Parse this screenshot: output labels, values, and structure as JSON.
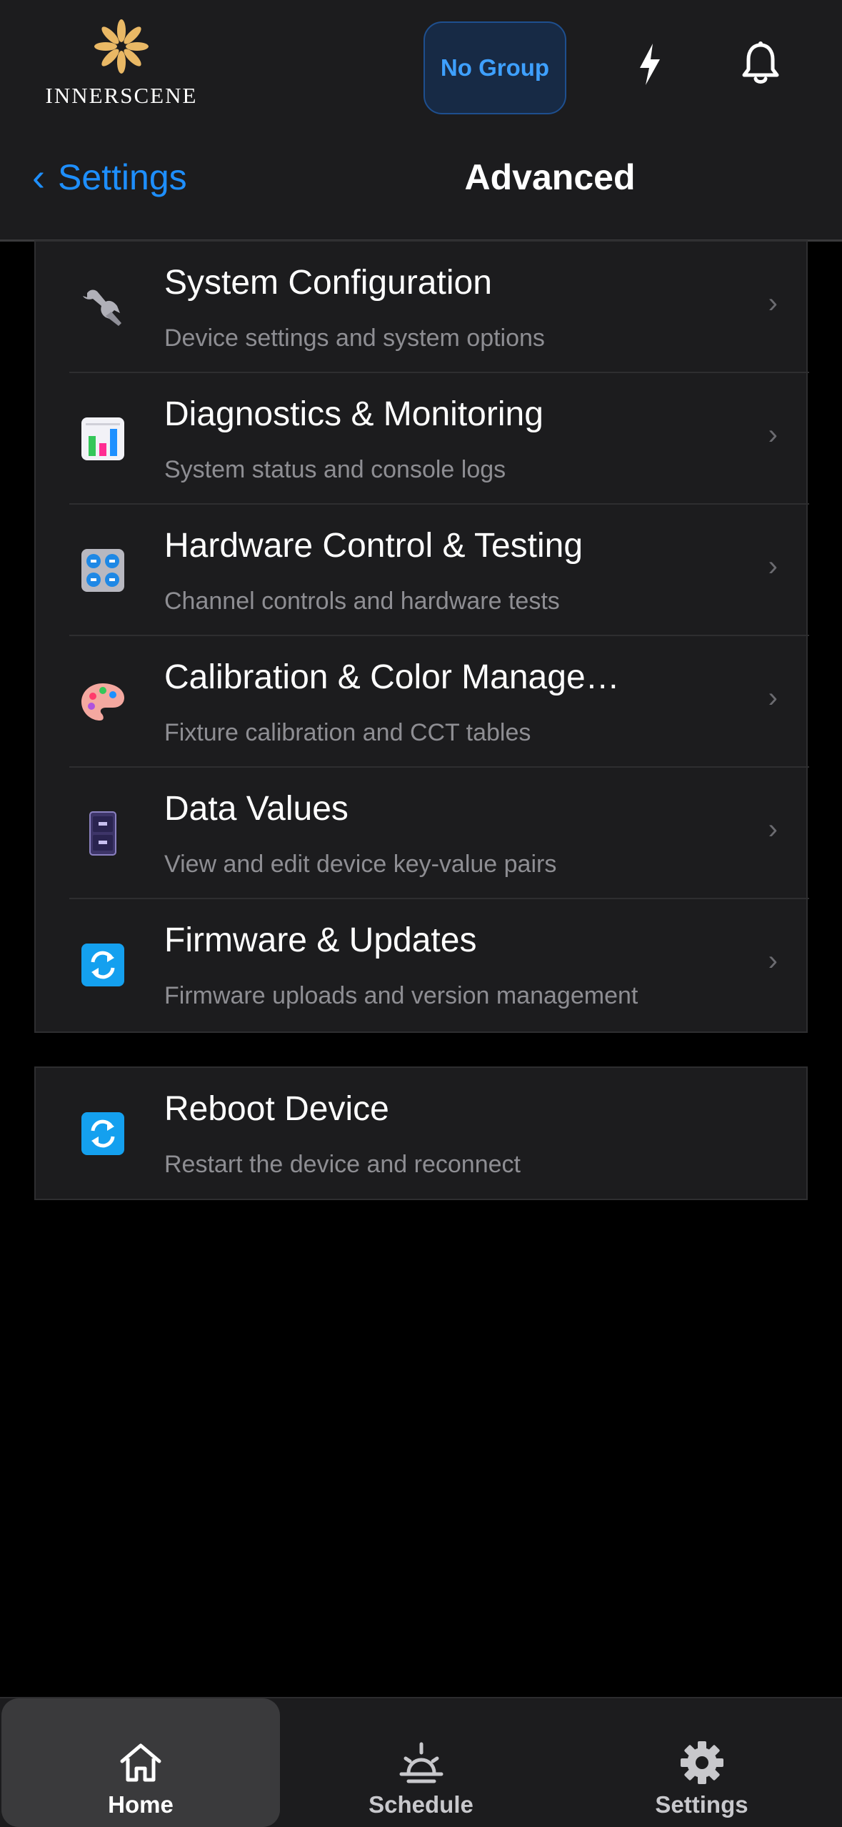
{
  "header": {
    "logo_text": "INNERSCENE",
    "group_button": "No Group"
  },
  "nav": {
    "back_label": "Settings",
    "title": "Advanced"
  },
  "menu": [
    {
      "title": "System Configuration",
      "subtitle": "Device settings and system options",
      "icon": "wrench-icon"
    },
    {
      "title": "Diagnostics & Monitoring",
      "subtitle": "System status and console logs",
      "icon": "bar-chart-icon"
    },
    {
      "title": "Hardware Control & Testing",
      "subtitle": "Channel controls and hardware tests",
      "icon": "control-knobs-icon"
    },
    {
      "title": "Calibration & Color Manage…",
      "subtitle": "Fixture calibration and CCT tables",
      "icon": "palette-icon"
    },
    {
      "title": "Data Values",
      "subtitle": "View and edit device key-value pairs",
      "icon": "file-cabinet-icon"
    },
    {
      "title": "Firmware & Updates",
      "subtitle": "Firmware uploads and version management",
      "icon": "refresh-icon"
    }
  ],
  "reboot": {
    "title": "Reboot Device",
    "subtitle": "Restart the device and reconnect",
    "icon": "refresh-icon"
  },
  "tabs": [
    {
      "label": "Home",
      "icon": "home-icon",
      "active": true
    },
    {
      "label": "Schedule",
      "icon": "sunrise-icon",
      "active": false
    },
    {
      "label": "Settings",
      "icon": "gear-icon",
      "active": false
    }
  ],
  "colors": {
    "accent": "#1e8fff",
    "background": "#000000",
    "surface": "#1c1c1e",
    "secondary_text": "#8e8e93"
  }
}
